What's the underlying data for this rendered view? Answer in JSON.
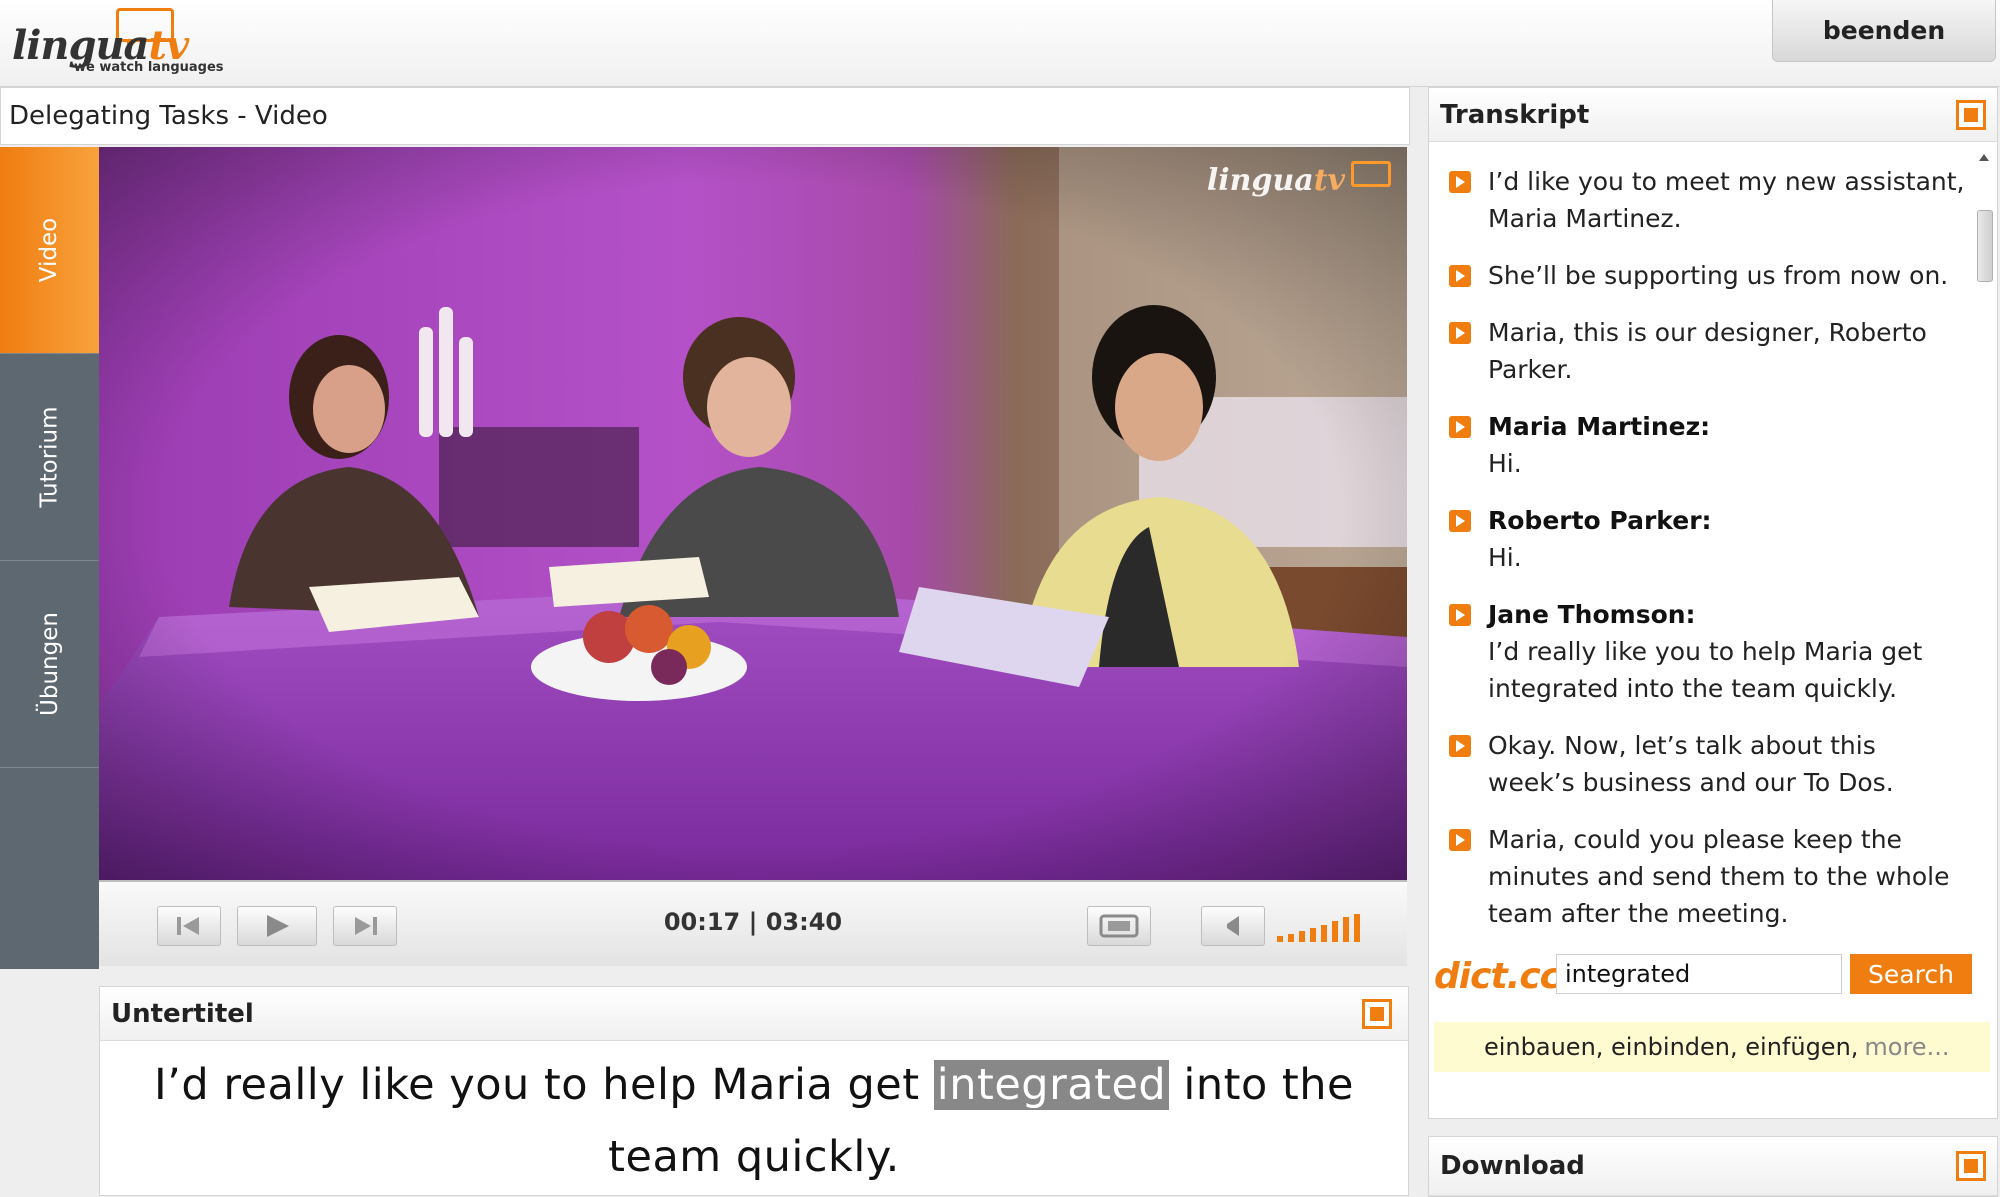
{
  "header": {
    "logo_word": "lingua",
    "logo_suffix": "tv",
    "logo_tagline": "we watch languages",
    "quit_label": "beenden"
  },
  "lesson": {
    "title": "Delegating Tasks - Video"
  },
  "side_tabs": [
    {
      "label": "Video",
      "active": true
    },
    {
      "label": "Tutorium",
      "active": false
    },
    {
      "label": "Übungen",
      "active": false
    }
  ],
  "video": {
    "watermark_word": "lingua",
    "watermark_suffix": "tv",
    "current_time": "00:17",
    "separator": "|",
    "duration": "03:40",
    "progress_fraction": 0.077,
    "volume_level_fraction": 1.0,
    "controls": [
      "previous-icon",
      "play-icon",
      "next-icon",
      "fullscreen-icon",
      "speaker-icon",
      "volume-bars-icon"
    ]
  },
  "subtitle": {
    "heading": "Untertitel",
    "before": "I’d really like you to help Maria get ",
    "highlight": "integrated",
    "after": " into the team quickly."
  },
  "transcript": {
    "heading": "Transkript",
    "items": [
      {
        "speaker": "",
        "text": "I’d like you to meet my new assistant, Maria Martinez."
      },
      {
        "speaker": "",
        "text": "She’ll be supporting us from now on."
      },
      {
        "speaker": "",
        "text": "Maria, this is our designer, Roberto Parker."
      },
      {
        "speaker": "Maria Martinez:",
        "text": "Hi."
      },
      {
        "speaker": "Roberto Parker:",
        "text": "Hi."
      },
      {
        "speaker": "Jane Thomson:",
        "text": "I’d really like you to help Maria get integrated into the team quickly."
      },
      {
        "speaker": "",
        "text": "Okay. Now, let’s talk about this week’s business and our To Dos."
      },
      {
        "speaker": "",
        "text": "Maria, could you please keep the minutes and send them to the whole team after the meeting."
      }
    ]
  },
  "dictionary": {
    "logo": "dict.cc",
    "query": "integrated",
    "button_label": "Search",
    "result": "einbauen, einbinden, einfügen,",
    "more_label": "more..."
  },
  "download": {
    "heading": "Download"
  },
  "colors": {
    "accent": "#f07d10",
    "sidebar": "#5d6870",
    "result_bg": "#fffbd0",
    "highlight_bg": "#888888"
  }
}
